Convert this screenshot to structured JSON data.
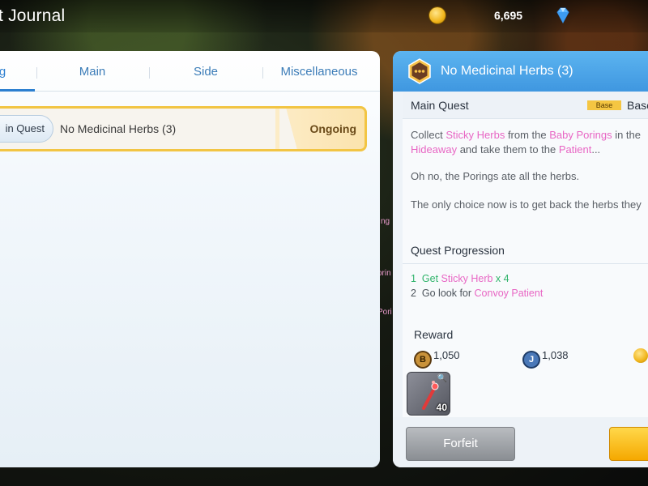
{
  "window": {
    "title": "t Journal"
  },
  "currency": {
    "coin_icon": "zeny-coin-icon",
    "coin_value": "6,695",
    "gem_icon": "diamond-icon"
  },
  "tabs": [
    {
      "label": "g",
      "active": true
    },
    {
      "label": "Main"
    },
    {
      "label": "Side"
    },
    {
      "label": "Miscellaneous"
    }
  ],
  "quest_list": [
    {
      "type_pill": "in Quest",
      "name": "No Medicinal Herbs (3)",
      "status": "Ongoing"
    }
  ],
  "detail": {
    "header_title": "No Medicinal Herbs (3)",
    "category": "Main Quest",
    "base_tag": "Base",
    "base_text": "Base",
    "desc1": {
      "p1": "Collect ",
      "h1": "Sticky Herbs",
      "p2": " from the ",
      "h2": "Baby Porings",
      "p3": " in the",
      "h3": "Hideaway",
      "p4": " and take them to the ",
      "h4": "Patient",
      "p5": "..."
    },
    "desc2": "Oh no, the Porings ate all the herbs.",
    "desc3": "The only choice now is to get back the herbs they",
    "progression_label": "Quest Progression",
    "progress": [
      {
        "num": "1",
        "pre": "Get ",
        "hl": "Sticky Herb",
        "post": " x 4"
      },
      {
        "num": "2",
        "pre": "Go look for ",
        "hl": "Convoy Patient",
        "post": ""
      }
    ],
    "reward_label": "Reward",
    "rewards": [
      {
        "icon": "B",
        "value": "1,050",
        "icon_name": "base-exp-icon"
      },
      {
        "icon": "J",
        "value": "1,038",
        "icon_name": "job-exp-icon"
      }
    ],
    "item": {
      "count": "40",
      "icon_name": "wand-item-icon"
    },
    "forfeit_label": "Forfeit"
  },
  "world_text": [
    "ng",
    "orin",
    "Pori"
  ],
  "colors": {
    "accent_blue": "#3f97e0",
    "highlight_pink": "#e866c4",
    "progress_green": "#2fb36a",
    "gold": "#f5c642"
  }
}
